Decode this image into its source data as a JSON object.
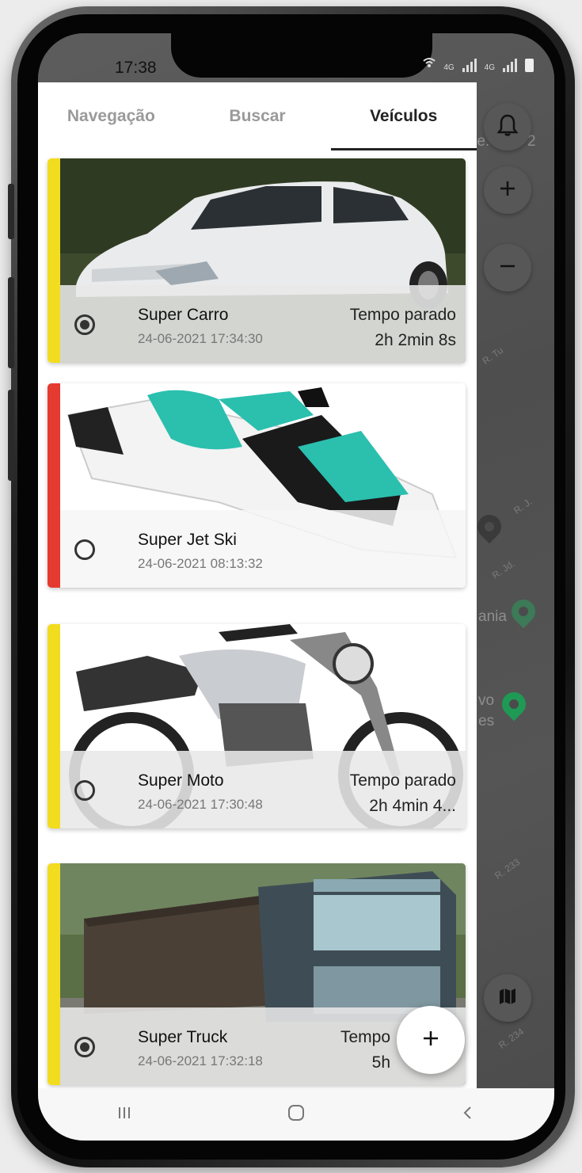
{
  "status_bar": {
    "time": "17:38",
    "network_1": "4G",
    "network_2": "4G"
  },
  "tabs": [
    {
      "label": "Navegação",
      "active": false
    },
    {
      "label": "Buscar",
      "active": false
    },
    {
      "label": "Veículos",
      "active": true
    }
  ],
  "map": {
    "labels": [
      {
        "text": "re."
      },
      {
        "text": "2"
      },
      {
        "text": "ania"
      },
      {
        "text": "vo"
      },
      {
        "text": "es"
      }
    ],
    "roads": [
      "R. Tu",
      "R. J.",
      "R. Jd.",
      "R. 233",
      "R. 234"
    ]
  },
  "vehicles": [
    {
      "name": "Super Carro",
      "timestamp": "24-06-2021 17:34:30",
      "status_label": "Tempo parado",
      "status_value": "2h 2min 8s",
      "selected": true,
      "accent": "#f2dc1f",
      "icon": "car-photo"
    },
    {
      "name": "Super Jet Ski",
      "timestamp": "24-06-2021 08:13:32",
      "status_label": "",
      "status_value": "",
      "selected": false,
      "accent": "#e53a2f",
      "icon": "jetski-photo"
    },
    {
      "name": "Super Moto",
      "timestamp": "24-06-2021 17:30:48",
      "status_label": "Tempo parado",
      "status_value": "2h 4min 4...",
      "selected": false,
      "accent": "#f2dc1f",
      "icon": "motorcycle-photo"
    },
    {
      "name": "Super Truck",
      "timestamp": "24-06-2021 17:32:18",
      "status_label": "Tempo",
      "status_value": "5h",
      "selected": true,
      "accent": "#f2dc1f",
      "icon": "truck-photo"
    }
  ],
  "fab": {
    "icon": "plus-icon"
  },
  "map_controls": {
    "bell": "bell-icon",
    "zoom_in": "plus-icon",
    "zoom_out": "minus-icon",
    "map_layers": "map-icon"
  },
  "nav_bar": {
    "recents": "recents-icon",
    "home": "home-icon",
    "back": "back-icon"
  },
  "colors": {
    "accent_yellow": "#f2dc1f",
    "accent_red": "#e53a2f",
    "jetski_teal": "#2bbfae",
    "map_pin_green": "#1e9a55"
  }
}
